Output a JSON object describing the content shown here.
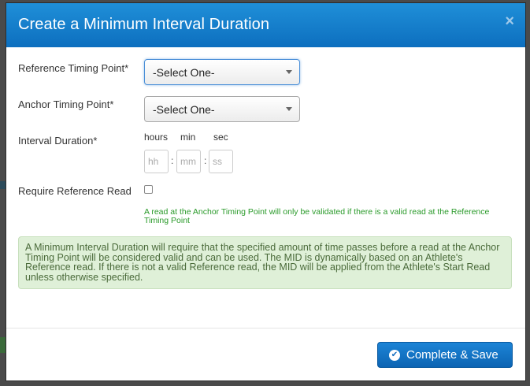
{
  "modal": {
    "title": "Create a Minimum Interval Duration",
    "close_glyph": "×"
  },
  "form": {
    "reference_timing_point": {
      "label": "Reference Timing Point*",
      "selected": "-Select One-"
    },
    "anchor_timing_point": {
      "label": "Anchor Timing Point*",
      "selected": "-Select One-"
    },
    "interval_duration": {
      "label": "Interval Duration*",
      "hours_label": "hours",
      "min_label": "min",
      "sec_label": "sec",
      "hours_placeholder": "hh",
      "min_placeholder": "mm",
      "sec_placeholder": "ss",
      "separator": ":"
    },
    "require_reference_read": {
      "label": "Require Reference Read",
      "checked": false,
      "help": "A read at the Anchor Timing Point will only be validated if there is a valid read at the Reference Timing Point"
    }
  },
  "info_text": "A Minimum Interval Duration will require that the specified amount of time passes before a read at the Anchor Timing Point will be considered valid and can be used. The MID is dynamically based on an Athlete's Reference read. If there is not a valid Reference read, the MID will be applied from the Athlete's Start Read unless otherwise specified.",
  "footer": {
    "save_label": "Complete & Save",
    "save_icon": "check-circle-icon"
  },
  "colors": {
    "header_blue": "#1a84d2",
    "help_green": "#2a9a2a",
    "info_bg": "#dff0d8"
  }
}
